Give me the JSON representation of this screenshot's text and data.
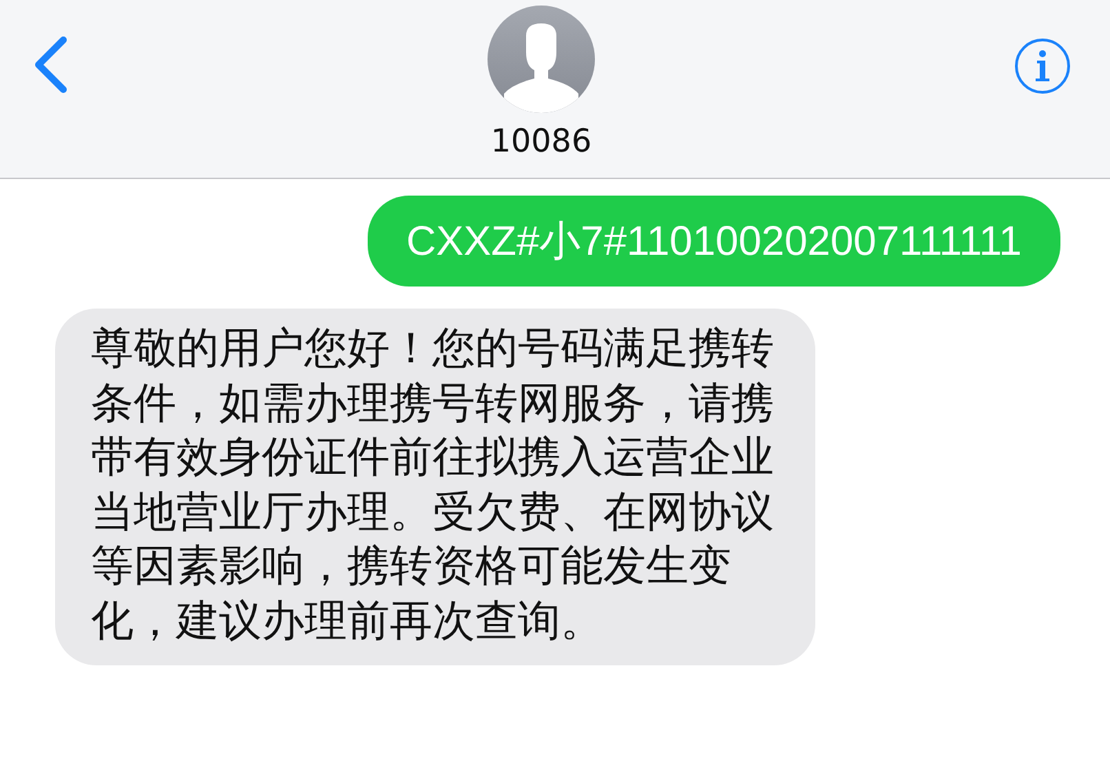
{
  "contact": {
    "name": "10086"
  },
  "messages": [
    {
      "kind": "sent",
      "text": "CXXZ#小7#110100202007111111"
    },
    {
      "kind": "received",
      "text": "尊敬的用户您好！您的号码满足携转条件，如需办理携号转网服务，请携带有效身份证件前往拟携入运营企业当地营业厅办理。受欠费、在网协议等因素影响，携转资格可能发生变化，建议办理前再次查询。"
    }
  ]
}
